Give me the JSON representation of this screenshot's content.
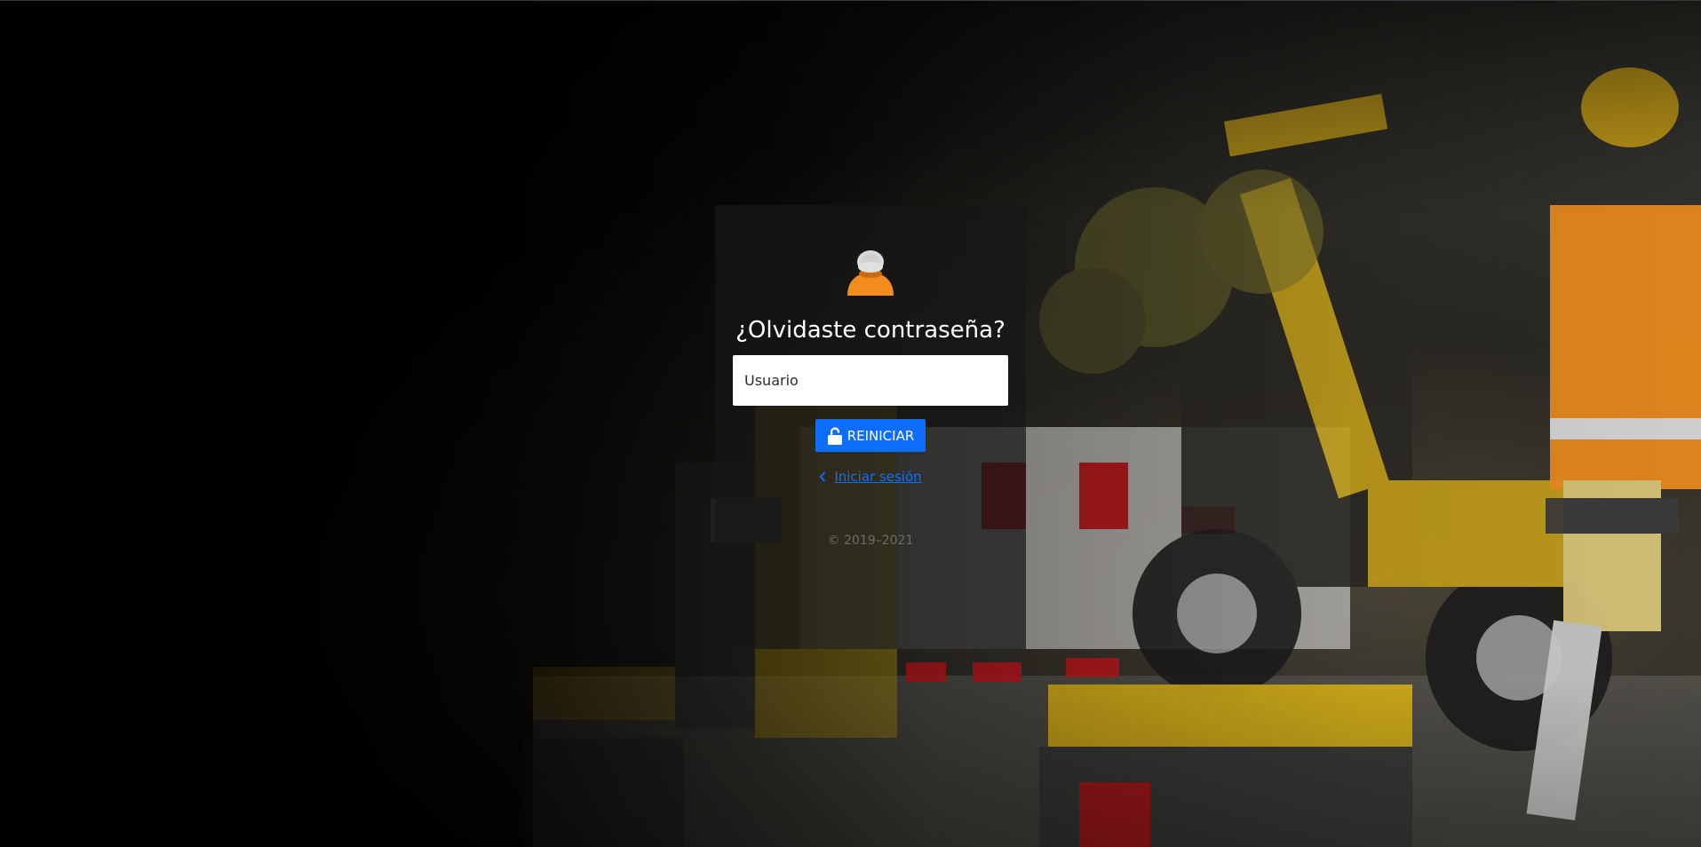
{
  "form": {
    "title": "¿Olvidaste contraseña?",
    "username_placeholder": "Usuario",
    "username_value": "",
    "submit_label": "REINICIAR",
    "back_link_label": "Iniciar sesión",
    "copyright": "© 2019–2021"
  },
  "icons": {
    "avatar": "user-avatar-icon",
    "submit": "unlock-icon",
    "back": "chevron-left-icon"
  },
  "colors": {
    "primary": "#0d6efd",
    "avatar_body": "#f28c1c",
    "avatar_head": "#d9d9d9",
    "card_bg": "#161616"
  }
}
